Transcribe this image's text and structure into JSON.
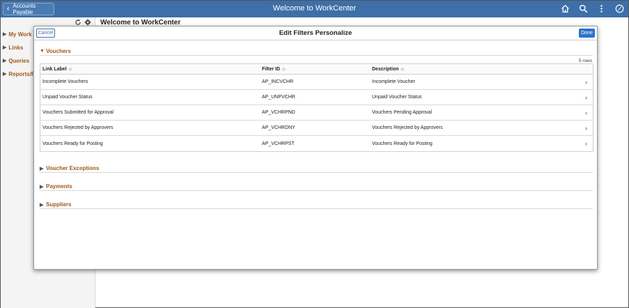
{
  "banner": {
    "back_label": "Accounts Payable",
    "title": "Welcome to WorkCenter",
    "icons": [
      "home-icon",
      "search-icon",
      "more-icon",
      "navbar-icon"
    ]
  },
  "left_nav": {
    "items": [
      "My Work",
      "Links",
      "Queries",
      "Reports/P"
    ]
  },
  "page": {
    "title": "Welcome to WorkCenter"
  },
  "modal": {
    "cancel_label": "Cancel",
    "title": "Edit Filters Personalize",
    "done_label": "Done"
  },
  "vouchers": {
    "section_label": "Vouchers",
    "rows_count": "5 rows",
    "columns": [
      "Link Label",
      "Filter ID",
      "Description"
    ],
    "rows": [
      {
        "label": "Incomplete Vouchers",
        "filter_id": "AP_INCVCHR",
        "description": "Incomplete Voucher"
      },
      {
        "label": "Unpaid Voucher Status",
        "filter_id": "AP_UNPVCHR",
        "description": "Unpaid Voucher Status"
      },
      {
        "label": "Vouchers Submitted for Approval",
        "filter_id": "AP_VCHRPND",
        "description": "Vouchers Pending Approval"
      },
      {
        "label": "Vouchers Rejected by Approvers",
        "filter_id": "AP_VCHRDNY",
        "description": "Vouchers Rejected by Approvers"
      },
      {
        "label": "Vouchers Ready for Posting",
        "filter_id": "AP_VCHRPST",
        "description": "Vouchers Ready for Posting"
      }
    ]
  },
  "collapsed_sections": [
    "Voucher Exceptions",
    "Payments",
    "Suppliers"
  ],
  "colors": {
    "banner": "#3e6fa8",
    "accent": "#a05a1c",
    "primary_button": "#2f73c9"
  }
}
